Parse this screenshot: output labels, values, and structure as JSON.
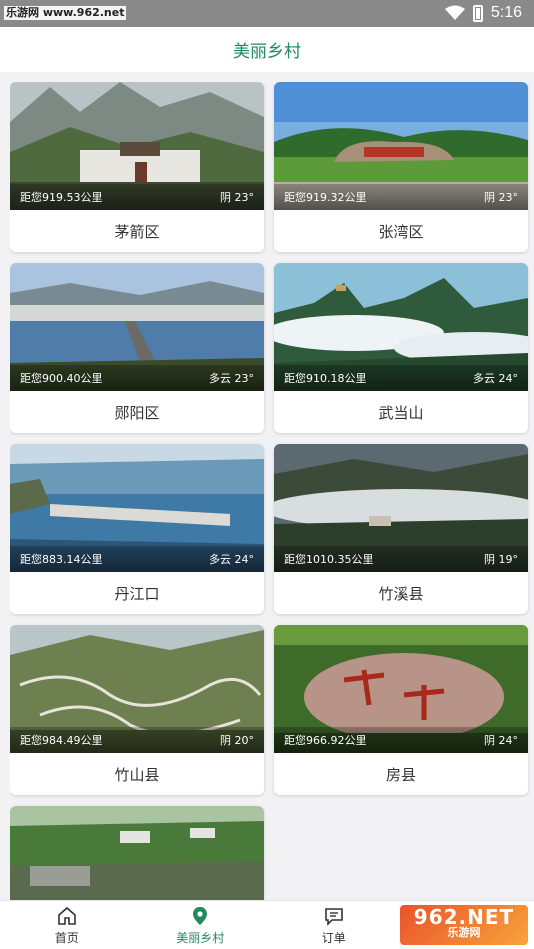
{
  "status": {
    "watermark": "乐游网 www.962.net",
    "time": "5:16"
  },
  "header": {
    "title": "美丽乡村"
  },
  "cards": [
    {
      "name": "茅箭区",
      "distance": "距您919.53公里",
      "weather": "阴 23°"
    },
    {
      "name": "张湾区",
      "distance": "距您919.32公里",
      "weather": "阴 23°"
    },
    {
      "name": "郧阳区",
      "distance": "距您900.40公里",
      "weather": "多云 23°"
    },
    {
      "name": "武当山",
      "distance": "距您910.18公里",
      "weather": "多云 24°"
    },
    {
      "name": "丹江口",
      "distance": "距您883.14公里",
      "weather": "多云 24°"
    },
    {
      "name": "竹溪县",
      "distance": "距您1010.35公里",
      "weather": "阴 19°"
    },
    {
      "name": "竹山县",
      "distance": "距您984.49公里",
      "weather": "阴 20°"
    },
    {
      "name": "房县",
      "distance": "距您966.92公里",
      "weather": "阴 24°"
    },
    {
      "name": "",
      "distance": "",
      "weather": ""
    }
  ],
  "tabs": [
    {
      "label": "首页",
      "icon": "home-icon"
    },
    {
      "label": "美丽乡村",
      "icon": "location-pin-icon"
    },
    {
      "label": "订单",
      "icon": "chat-icon"
    }
  ],
  "brand_badge": {
    "big": "962.NET",
    "small": "乐游网"
  },
  "colors": {
    "accent": "#1f8a5e",
    "status_bar": "#8a8a8a"
  }
}
